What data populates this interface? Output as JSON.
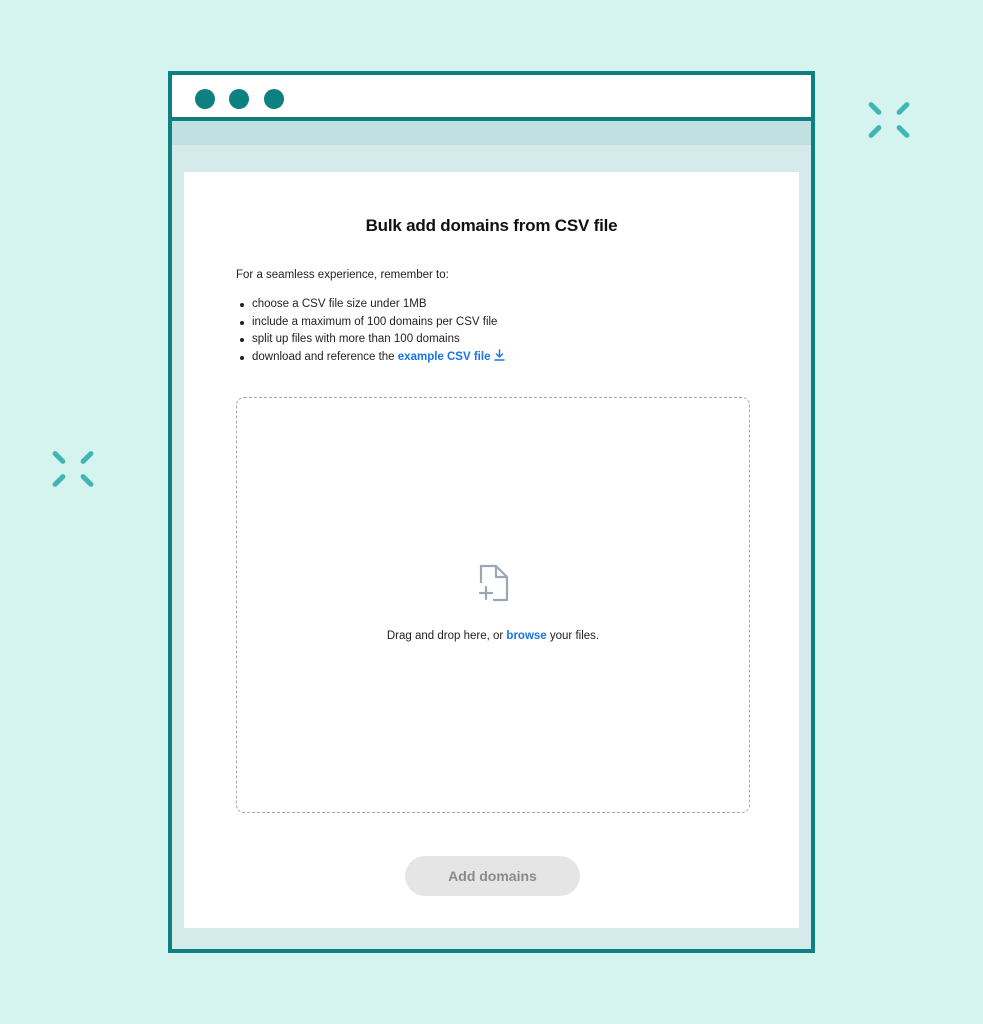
{
  "modal": {
    "title": "Bulk add domains from CSV file",
    "intro": "For a seamless experience, remember to:",
    "tips": [
      "choose a CSV file size under 1MB",
      "include a maximum of 100 domains per CSV file",
      "split up files with more than 100 domains"
    ],
    "download_tip_prefix": "download and reference the ",
    "example_link": "example CSV file",
    "dropzone": {
      "text_before": "Drag and drop here, or ",
      "browse_link": "browse",
      "text_after": " your files."
    },
    "submit_button": "Add domains"
  },
  "icons": {
    "download": "download-icon",
    "file_add": "file-add-icon",
    "window_dots": "window-dot-icon",
    "sparkle": "sparkle-icon"
  },
  "colors": {
    "background": "#d5f3ef",
    "window_frame": "#0d8080",
    "window_chrome": "#c0e0e2",
    "link": "#1a73e8",
    "sparkle": "#3fb6b5",
    "button_disabled_bg": "#e5e5e5",
    "button_disabled_text": "#8a8a8a"
  }
}
